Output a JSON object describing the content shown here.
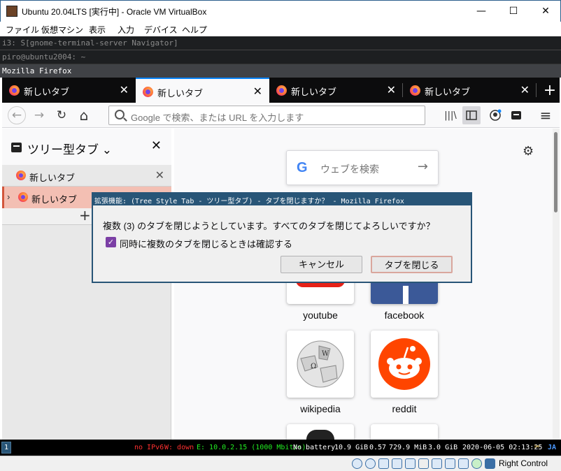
{
  "window": {
    "title": "Ubuntu 20.04LTS [実行中] - Oracle VM VirtualBox",
    "minimize": "—",
    "maximize": "☐",
    "close": "✕"
  },
  "menu": [
    "ファイル",
    "仮想マシン",
    "表示",
    "入力",
    "デバイス",
    "ヘルプ"
  ],
  "i3": {
    "line1": "i3: S[gnome-terminal-server Navigator]",
    "line2": "piro@ubuntu2004: ~",
    "line3": "Mozilla Firefox"
  },
  "tabs": [
    {
      "label": "新しいタブ",
      "close": "✕"
    },
    {
      "label": "新しいタブ",
      "close": "✕"
    },
    {
      "label": "新しいタブ",
      "close": "✕"
    },
    {
      "label": "新しいタブ",
      "close": "✕"
    }
  ],
  "newtab": "+",
  "nav": {
    "back": "←",
    "forward": "→",
    "reload": "↻",
    "home": "⌂",
    "placeholder": "Google で検索、または URL を入力します",
    "library": "|||\\",
    "menu": "≡"
  },
  "sidebar": {
    "title": "ツリー型タブ ⌄",
    "close": "✕",
    "items": [
      {
        "label": "新しいタブ",
        "close": "✕"
      },
      {
        "label": "新しいタブ",
        "twisty": "›"
      }
    ],
    "add": "+"
  },
  "newtab_page": {
    "search_g": "G",
    "search_placeholder": "ウェブを検索",
    "search_arrow": "→",
    "gear": "⚙",
    "sites": [
      "youtube",
      "facebook",
      "wikipedia",
      "reddit"
    ]
  },
  "dialog": {
    "title": "拡張機能: (Tree Style Tab - ツリー型タブ) - タブを閉じますか？ - Mozilla Firefox",
    "message": "複数 (3) のタブを閉じようとしています。すべてのタブを閉じてよろしいですか？",
    "checkbox_label": "同時に複数のタブを閉じるときは確認する",
    "checked": true,
    "check_mark": "✓",
    "cancel": "キャンセル",
    "confirm": "タブを閉じる"
  },
  "statusbar": {
    "workspace": "1",
    "ipv6": "no IPv6",
    "wifi": "W: down",
    "eth": "E: 10.0.2.15 (1000 Mbit/s)",
    "battery": "No battery",
    "disk": "10.9 GiB",
    "load": "0.57",
    "mem": "729.9 MiB",
    "free": "3.0 GiB",
    "datetime": "2020-06-05 02:13:25",
    "lang": "JA"
  },
  "vbox": {
    "hostkey": "Right Control"
  },
  "colors": {
    "i3_focus": "#285577",
    "firefox_accent": "#0a84ff",
    "tst_active": "#f3bfb3"
  }
}
